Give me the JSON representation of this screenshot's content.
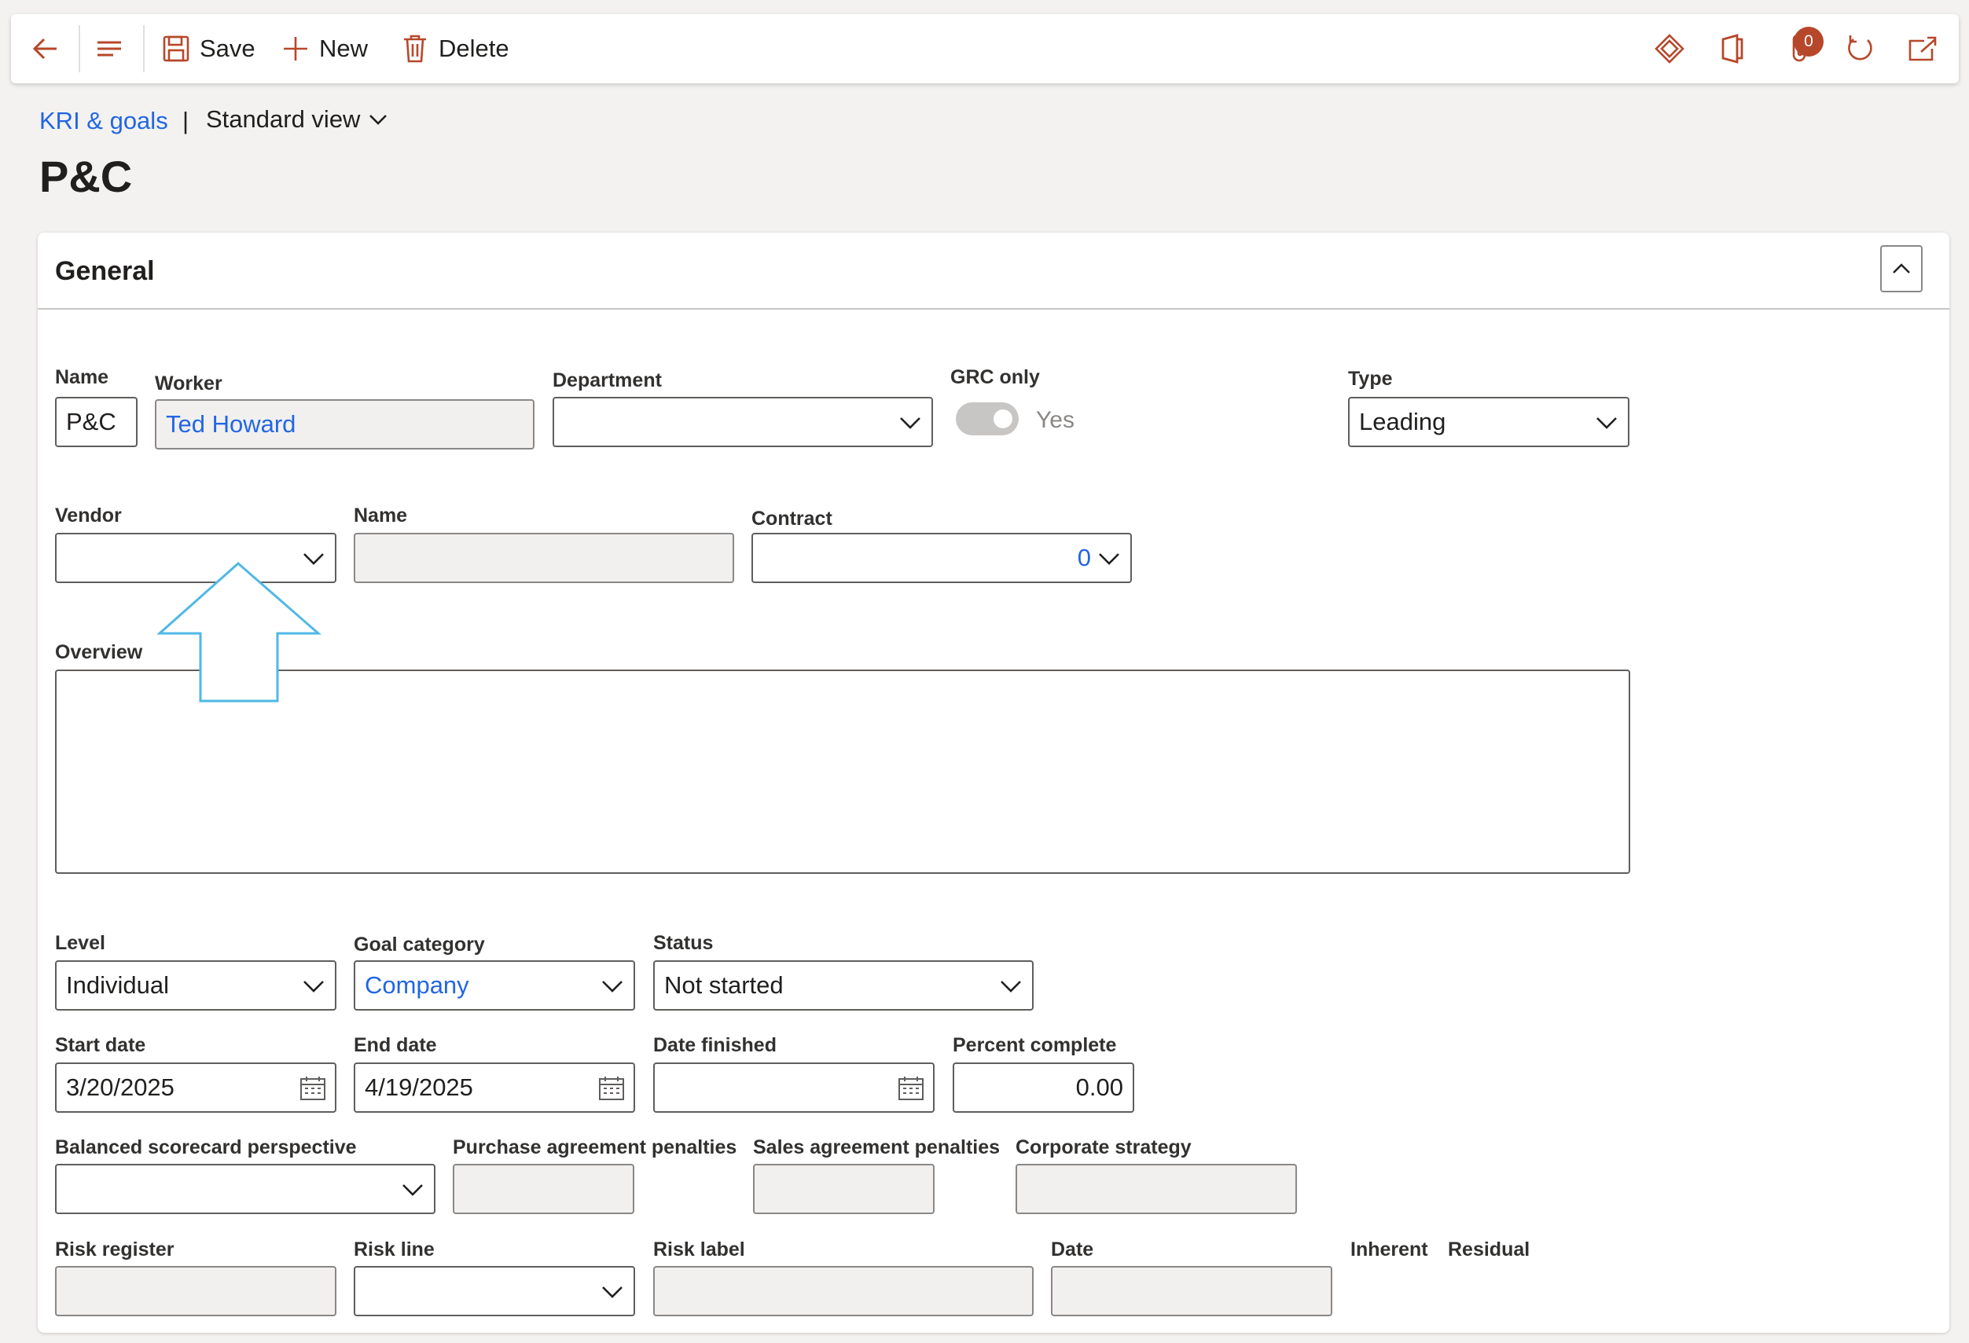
{
  "toolbar": {
    "save_label": "Save",
    "new_label": "New",
    "delete_label": "Delete",
    "attachments_count": "0"
  },
  "breadcrumb": {
    "link": "KRI & goals",
    "separator": "|",
    "view": "Standard view"
  },
  "page": {
    "title": "P&C"
  },
  "section": {
    "title": "General"
  },
  "form": {
    "name_label": "Name",
    "name_value": "P&C",
    "worker_label": "Worker",
    "worker_value": "Ted Howard",
    "department_label": "Department",
    "department_value": "",
    "grc_label": "GRC only",
    "grc_value": "Yes",
    "type_label": "Type",
    "type_value": "Leading",
    "vendor_label": "Vendor",
    "vendor_value": "",
    "vendor_name_label": "Name",
    "vendor_name_value": "",
    "contract_label": "Contract",
    "contract_value": "0",
    "overview_label": "Overview",
    "overview_value": "",
    "level_label": "Level",
    "level_value": "Individual",
    "goal_category_label": "Goal category",
    "goal_category_value": "Company",
    "status_label": "Status",
    "status_value": "Not started",
    "start_date_label": "Start date",
    "start_date_value": "3/20/2025",
    "end_date_label": "End date",
    "end_date_value": "4/19/2025",
    "date_finished_label": "Date finished",
    "date_finished_value": "",
    "percent_complete_label": "Percent complete",
    "percent_complete_value": "0.00",
    "bsc_label": "Balanced scorecard perspective",
    "bsc_value": "",
    "purchase_penalties_label": "Purchase agreement penalties",
    "sales_penalties_label": "Sales agreement penalties",
    "corporate_strategy_label": "Corporate strategy",
    "risk_register_label": "Risk register",
    "risk_line_label": "Risk line",
    "risk_label_label": "Risk label",
    "date_label": "Date",
    "inherent_label": "Inherent",
    "residual_label": "Residual"
  },
  "colors": {
    "accent": "#b7472a",
    "link": "#2266e3",
    "annotation": "#4fb8e6"
  }
}
